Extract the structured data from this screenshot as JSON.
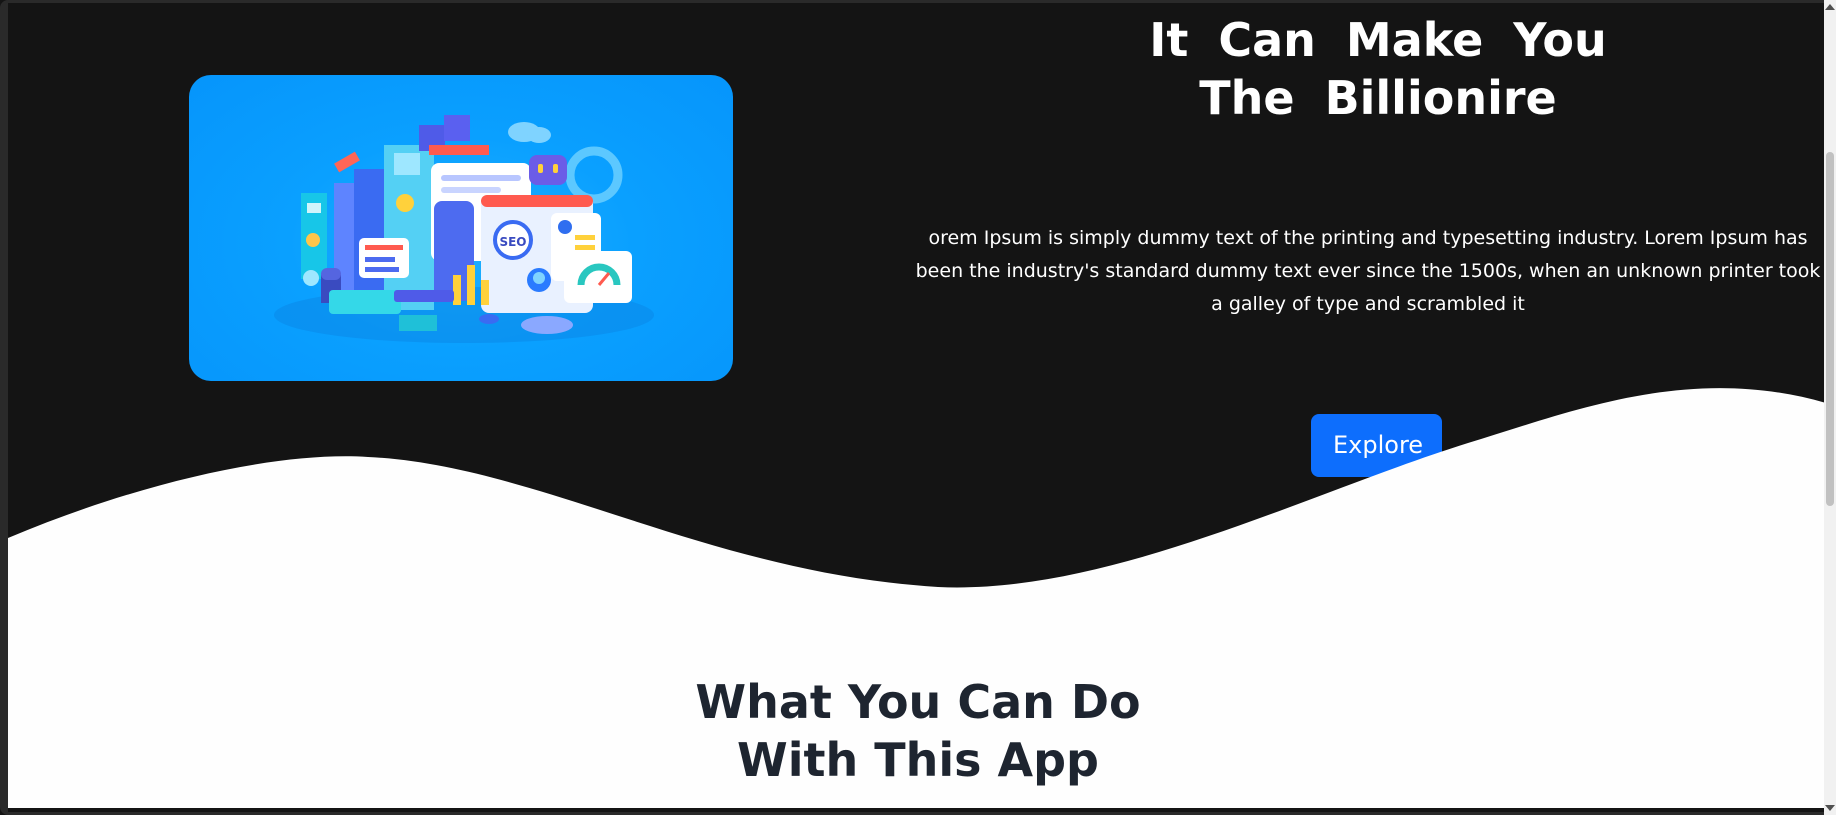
{
  "hero": {
    "title_line1": "It  Can  Make  You",
    "title_line2": "The  Billionire",
    "description": "orem Ipsum is simply dummy text of the printing and typesetting industry. Lorem Ipsum has been the industry's standard dummy text ever since the 1500s, when an unknown printer took a galley of type and scrambled it",
    "explore_label": "Explore",
    "image_badge_text": "SEO"
  },
  "section": {
    "title_line1": "What You Can Do",
    "title_line2": "With This App"
  },
  "colors": {
    "background": "#141414",
    "accent": "#0d6efd",
    "wave": "#fefefe",
    "image_blue": "#0aa0ff"
  },
  "icons": {
    "hero_image": "seo-illustration",
    "scroll_up": "scroll-up-arrow-icon",
    "scroll_down": "scroll-down-arrow-icon"
  }
}
